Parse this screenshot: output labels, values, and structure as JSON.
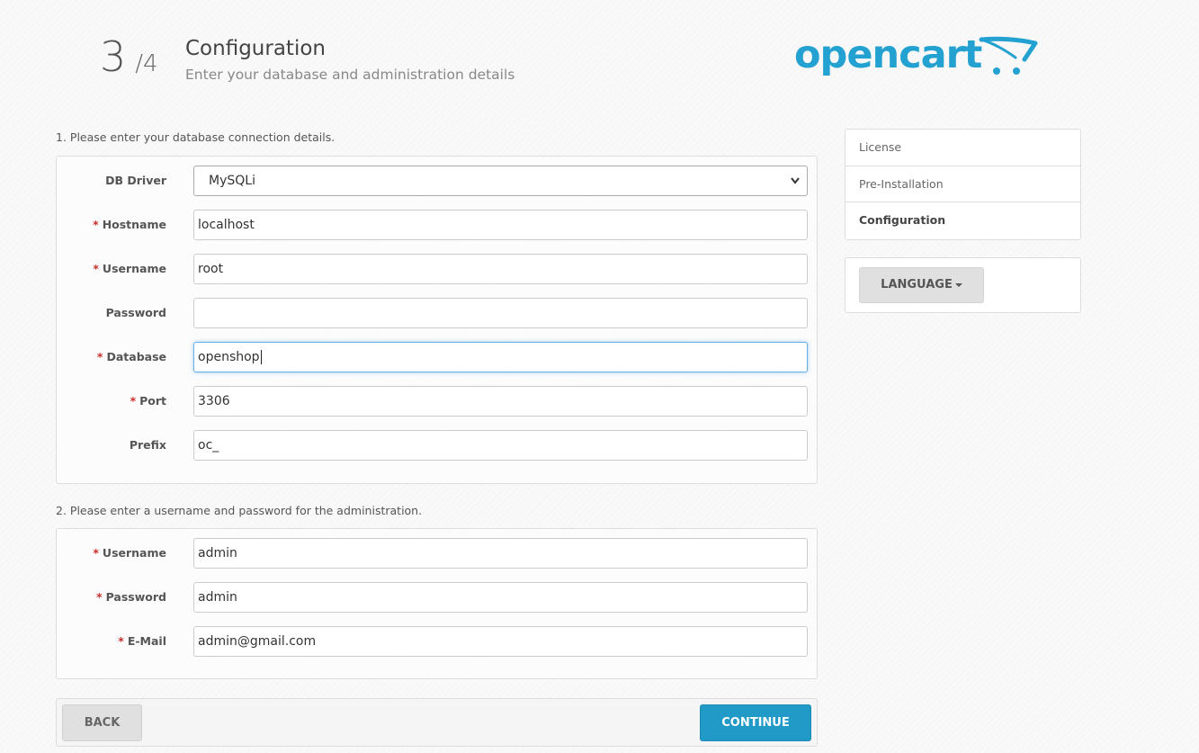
{
  "header": {
    "step_current": "3",
    "step_total": "/4",
    "title": "Configuration",
    "subtitle": "Enter your database and administration details",
    "logo_text": "opencart",
    "brand_color": "#23a1d1"
  },
  "db_section": {
    "label": "1. Please enter your database connection details.",
    "fields": {
      "driver": {
        "label": "DB Driver",
        "value": "MySQLi"
      },
      "hostname": {
        "required": "*",
        "label": "Hostname",
        "value": "localhost"
      },
      "username": {
        "required": "*",
        "label": "Username",
        "value": "root"
      },
      "password": {
        "label": "Password",
        "value": ""
      },
      "database": {
        "required": "*",
        "label": "Database",
        "value": "openshop"
      },
      "port": {
        "required": "*",
        "label": "Port",
        "value": "3306"
      },
      "prefix": {
        "label": "Prefix",
        "value": "oc_"
      }
    }
  },
  "admin_section": {
    "label": "2. Please enter a username and password for the administration.",
    "fields": {
      "username": {
        "required": "*",
        "label": "Username",
        "value": "admin"
      },
      "password": {
        "required": "*",
        "label": "Password",
        "value": "admin"
      },
      "email": {
        "required": "*",
        "label": "E-Mail",
        "value": "admin@gmail.com"
      }
    }
  },
  "sidebar": {
    "steps": [
      "License",
      "Pre-Installation",
      "Configuration"
    ],
    "language_button": "LANGUAGE"
  },
  "buttons": {
    "back": "BACK",
    "continue": "CONTINUE",
    "continue_color": "#229ac8"
  }
}
